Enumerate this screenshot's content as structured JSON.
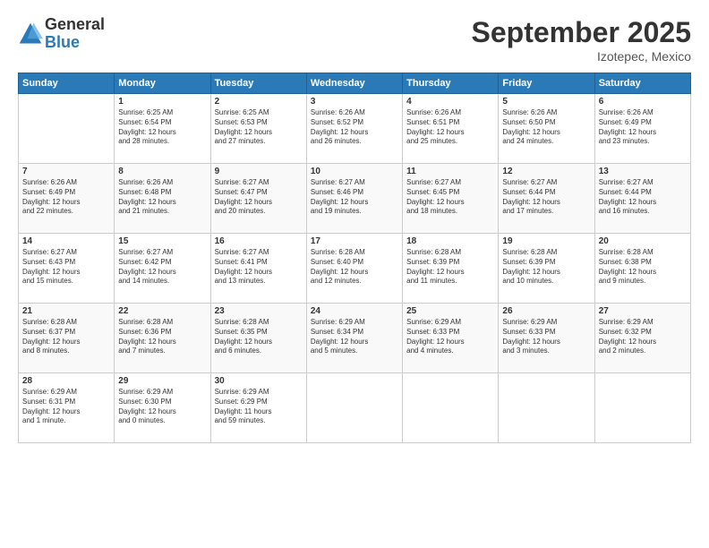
{
  "logo": {
    "general": "General",
    "blue": "Blue"
  },
  "title": "September 2025",
  "subtitle": "Izotepec, Mexico",
  "headers": [
    "Sunday",
    "Monday",
    "Tuesday",
    "Wednesday",
    "Thursday",
    "Friday",
    "Saturday"
  ],
  "weeks": [
    [
      {
        "day": "",
        "info": ""
      },
      {
        "day": "1",
        "info": "Sunrise: 6:25 AM\nSunset: 6:54 PM\nDaylight: 12 hours\nand 28 minutes."
      },
      {
        "day": "2",
        "info": "Sunrise: 6:25 AM\nSunset: 6:53 PM\nDaylight: 12 hours\nand 27 minutes."
      },
      {
        "day": "3",
        "info": "Sunrise: 6:26 AM\nSunset: 6:52 PM\nDaylight: 12 hours\nand 26 minutes."
      },
      {
        "day": "4",
        "info": "Sunrise: 6:26 AM\nSunset: 6:51 PM\nDaylight: 12 hours\nand 25 minutes."
      },
      {
        "day": "5",
        "info": "Sunrise: 6:26 AM\nSunset: 6:50 PM\nDaylight: 12 hours\nand 24 minutes."
      },
      {
        "day": "6",
        "info": "Sunrise: 6:26 AM\nSunset: 6:49 PM\nDaylight: 12 hours\nand 23 minutes."
      }
    ],
    [
      {
        "day": "7",
        "info": "Sunrise: 6:26 AM\nSunset: 6:49 PM\nDaylight: 12 hours\nand 22 minutes."
      },
      {
        "day": "8",
        "info": "Sunrise: 6:26 AM\nSunset: 6:48 PM\nDaylight: 12 hours\nand 21 minutes."
      },
      {
        "day": "9",
        "info": "Sunrise: 6:27 AM\nSunset: 6:47 PM\nDaylight: 12 hours\nand 20 minutes."
      },
      {
        "day": "10",
        "info": "Sunrise: 6:27 AM\nSunset: 6:46 PM\nDaylight: 12 hours\nand 19 minutes."
      },
      {
        "day": "11",
        "info": "Sunrise: 6:27 AM\nSunset: 6:45 PM\nDaylight: 12 hours\nand 18 minutes."
      },
      {
        "day": "12",
        "info": "Sunrise: 6:27 AM\nSunset: 6:44 PM\nDaylight: 12 hours\nand 17 minutes."
      },
      {
        "day": "13",
        "info": "Sunrise: 6:27 AM\nSunset: 6:44 PM\nDaylight: 12 hours\nand 16 minutes."
      }
    ],
    [
      {
        "day": "14",
        "info": "Sunrise: 6:27 AM\nSunset: 6:43 PM\nDaylight: 12 hours\nand 15 minutes."
      },
      {
        "day": "15",
        "info": "Sunrise: 6:27 AM\nSunset: 6:42 PM\nDaylight: 12 hours\nand 14 minutes."
      },
      {
        "day": "16",
        "info": "Sunrise: 6:27 AM\nSunset: 6:41 PM\nDaylight: 12 hours\nand 13 minutes."
      },
      {
        "day": "17",
        "info": "Sunrise: 6:28 AM\nSunset: 6:40 PM\nDaylight: 12 hours\nand 12 minutes."
      },
      {
        "day": "18",
        "info": "Sunrise: 6:28 AM\nSunset: 6:39 PM\nDaylight: 12 hours\nand 11 minutes."
      },
      {
        "day": "19",
        "info": "Sunrise: 6:28 AM\nSunset: 6:39 PM\nDaylight: 12 hours\nand 10 minutes."
      },
      {
        "day": "20",
        "info": "Sunrise: 6:28 AM\nSunset: 6:38 PM\nDaylight: 12 hours\nand 9 minutes."
      }
    ],
    [
      {
        "day": "21",
        "info": "Sunrise: 6:28 AM\nSunset: 6:37 PM\nDaylight: 12 hours\nand 8 minutes."
      },
      {
        "day": "22",
        "info": "Sunrise: 6:28 AM\nSunset: 6:36 PM\nDaylight: 12 hours\nand 7 minutes."
      },
      {
        "day": "23",
        "info": "Sunrise: 6:28 AM\nSunset: 6:35 PM\nDaylight: 12 hours\nand 6 minutes."
      },
      {
        "day": "24",
        "info": "Sunrise: 6:29 AM\nSunset: 6:34 PM\nDaylight: 12 hours\nand 5 minutes."
      },
      {
        "day": "25",
        "info": "Sunrise: 6:29 AM\nSunset: 6:33 PM\nDaylight: 12 hours\nand 4 minutes."
      },
      {
        "day": "26",
        "info": "Sunrise: 6:29 AM\nSunset: 6:33 PM\nDaylight: 12 hours\nand 3 minutes."
      },
      {
        "day": "27",
        "info": "Sunrise: 6:29 AM\nSunset: 6:32 PM\nDaylight: 12 hours\nand 2 minutes."
      }
    ],
    [
      {
        "day": "28",
        "info": "Sunrise: 6:29 AM\nSunset: 6:31 PM\nDaylight: 12 hours\nand 1 minute."
      },
      {
        "day": "29",
        "info": "Sunrise: 6:29 AM\nSunset: 6:30 PM\nDaylight: 12 hours\nand 0 minutes."
      },
      {
        "day": "30",
        "info": "Sunrise: 6:29 AM\nSunset: 6:29 PM\nDaylight: 11 hours\nand 59 minutes."
      },
      {
        "day": "",
        "info": ""
      },
      {
        "day": "",
        "info": ""
      },
      {
        "day": "",
        "info": ""
      },
      {
        "day": "",
        "info": ""
      }
    ]
  ]
}
